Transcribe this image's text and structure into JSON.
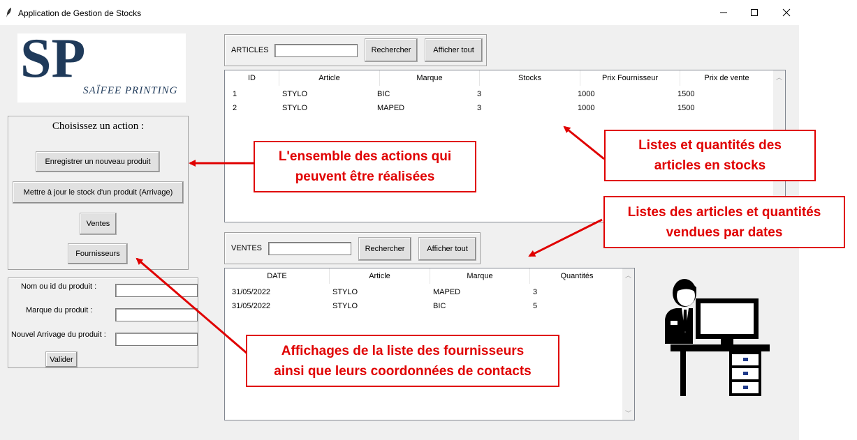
{
  "window": {
    "title": "Application de Gestion de Stocks"
  },
  "logo": {
    "monogram": "SP",
    "brand": "SAÏFEE PRINTING"
  },
  "actions": {
    "heading": "Choisissez un action :",
    "btn_new": "Enregistrer un nouveau produit",
    "btn_update": "Mettre à jour le stock d'un produit (Arrivage)",
    "btn_sales": "Ventes",
    "btn_suppliers": "Fournisseurs"
  },
  "form": {
    "name_label": "Nom ou id du produit :",
    "brand_label": "Marque du produit :",
    "arrival_label": "Nouvel Arrivage du produit :",
    "submit": "Valider",
    "name_value": "",
    "brand_value": "",
    "arrival_value": ""
  },
  "articles": {
    "label": "ARTICLES",
    "search_value": "",
    "search_btn": "Rechercher",
    "show_all_btn": "Afficher tout",
    "columns": [
      "ID",
      "Article",
      "Marque",
      "Stocks",
      "Prix Fournisseur",
      "Prix de vente"
    ],
    "rows": [
      [
        "1",
        "STYLO",
        "BIC",
        "3",
        "1000",
        "1500"
      ],
      [
        "2",
        "STYLO",
        "MAPED",
        "3",
        "1000",
        "1500"
      ]
    ]
  },
  "ventes": {
    "label": "VENTES",
    "search_value": "",
    "search_btn": "Rechercher",
    "show_all_btn": "Afficher tout",
    "columns": [
      "DATE",
      "Article",
      "Marque",
      "Quantités"
    ],
    "rows": [
      [
        "31/05/2022",
        "STYLO",
        "MAPED",
        "3"
      ],
      [
        "31/05/2022",
        "STYLO",
        "BIC",
        "5"
      ]
    ]
  },
  "callouts": {
    "actions_1": "L'ensemble des actions qui",
    "actions_2": "peuvent être réalisées",
    "stock_1": "Listes et quantités des",
    "stock_2": "articles en stocks",
    "sales_1": "Listes des articles et quantités",
    "sales_2": "vendues par dates",
    "suppliers_1": "Affichages de la liste des fournisseurs",
    "suppliers_2": "ainsi que leurs coordonnées de contacts"
  },
  "colors": {
    "callout_red": "#e00000",
    "logo_navy": "#1f3a5a"
  }
}
